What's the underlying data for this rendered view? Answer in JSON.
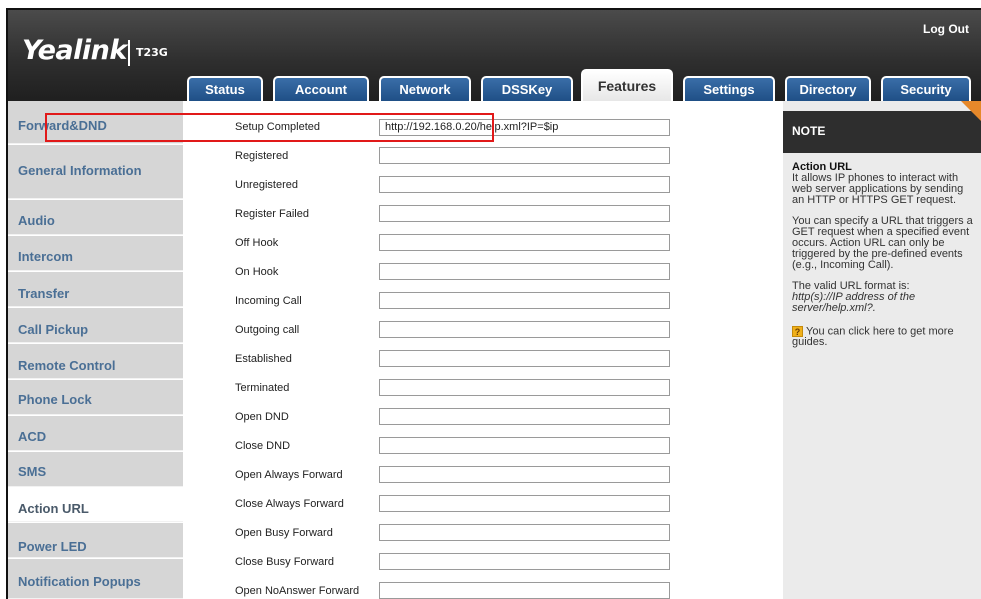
{
  "header": {
    "brand": "Yealink",
    "model": "T23G",
    "logout_label": "Log Out"
  },
  "tabs": [
    {
      "label": "Status",
      "active": false
    },
    {
      "label": "Account",
      "active": false
    },
    {
      "label": "Network",
      "active": false
    },
    {
      "label": "DSSKey",
      "active": false
    },
    {
      "label": "Features",
      "active": true
    },
    {
      "label": "Settings",
      "active": false
    },
    {
      "label": "Directory",
      "active": false
    },
    {
      "label": "Security",
      "active": false
    }
  ],
  "sidebar": {
    "items": [
      {
        "label": "Forward&DND"
      },
      {
        "label": "General Information"
      },
      {
        "label": "Audio"
      },
      {
        "label": "Intercom"
      },
      {
        "label": "Transfer"
      },
      {
        "label": "Call Pickup"
      },
      {
        "label": "Remote Control"
      },
      {
        "label": "Phone Lock"
      },
      {
        "label": "ACD"
      },
      {
        "label": "SMS"
      },
      {
        "label": "Action URL",
        "active": true
      },
      {
        "label": "Power LED"
      },
      {
        "label": "Notification Popups"
      }
    ]
  },
  "form": {
    "rows": [
      {
        "label": "Setup Completed",
        "value": "http://192.168.0.20/help.xml?IP=$ip",
        "has_input": true
      },
      {
        "label": "Registered",
        "value": "",
        "has_input": true
      },
      {
        "label": "Unregistered",
        "value": "",
        "has_input": true
      },
      {
        "label": "Register Failed",
        "value": "",
        "has_input": true
      },
      {
        "label": "Off Hook",
        "value": "",
        "has_input": true
      },
      {
        "label": "On Hook",
        "value": "",
        "has_input": true
      },
      {
        "label": "Incoming Call",
        "value": "",
        "has_input": true
      },
      {
        "label": "Outgoing call",
        "value": "",
        "has_input": true
      },
      {
        "label": "Established",
        "value": "",
        "has_input": true
      },
      {
        "label": "Terminated",
        "value": "",
        "has_input": true
      },
      {
        "label": "Open DND",
        "value": "",
        "has_input": true
      },
      {
        "label": "Close DND",
        "value": "",
        "has_input": true
      },
      {
        "label": "Open Always Forward",
        "value": "",
        "has_input": true
      },
      {
        "label": "Close Always Forward",
        "value": "",
        "has_input": true
      },
      {
        "label": "Open Busy Forward",
        "value": "",
        "has_input": true
      },
      {
        "label": "Close Busy Forward",
        "value": "",
        "has_input": true
      },
      {
        "label": "Open NoAnswer Forward",
        "value": "",
        "has_input": true
      }
    ]
  },
  "note": {
    "title": "NOTE",
    "heading": "Action URL",
    "para1": "It allows IP phones to interact with web server applications by sending an HTTP or HTTPS GET request.",
    "para2": "You can specify a URL that triggers a GET request when a specified event occurs. Action URL can only be triggered by the pre-defined events (e.g., Incoming Call).",
    "para3_prefix": "The valid URL format is:",
    "para3_format": "http(s)://IP address of the server/help.xml?.",
    "help_text": "You can click here to get more guides."
  },
  "colors": {
    "header_bg": "#2f2f2f",
    "tab_blue": "#2a5f9a",
    "nav_link": "#4a6f95",
    "nav_bg": "#d6d6d6",
    "highlight": "#e11919",
    "note_accent": "#e6882a"
  }
}
